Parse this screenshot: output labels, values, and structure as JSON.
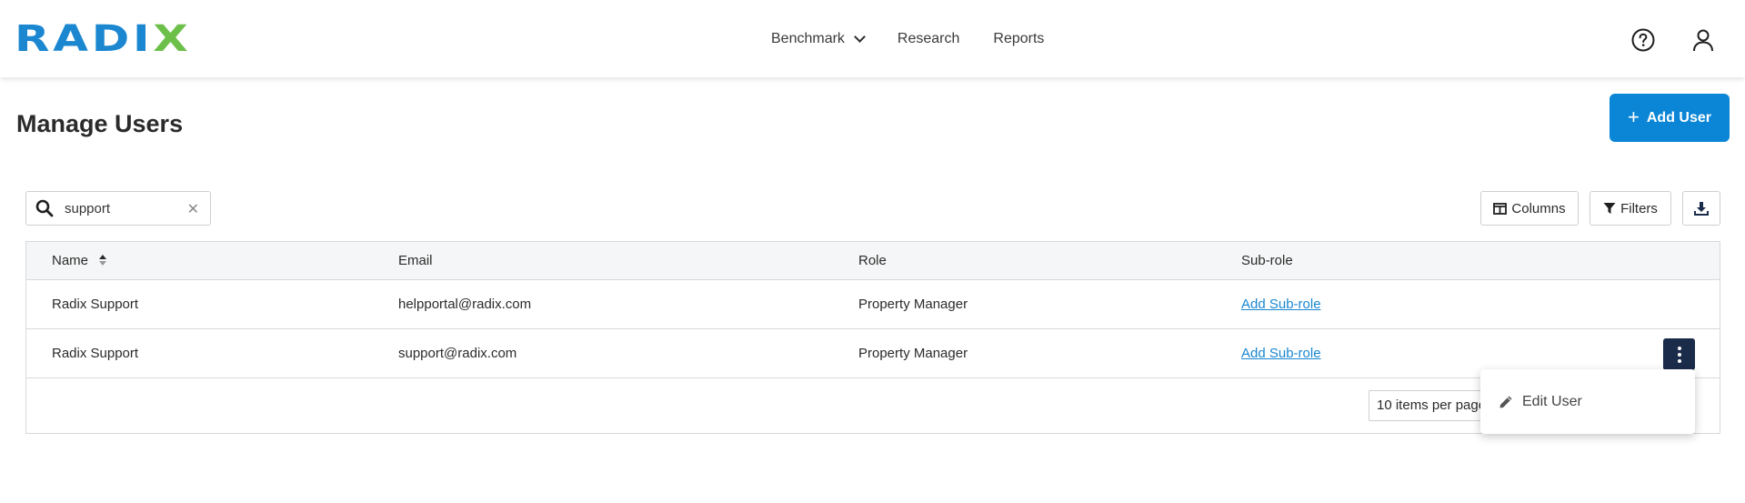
{
  "header": {
    "logo_main": "RADI",
    "logo_accent": "X",
    "nav": [
      {
        "label": "Benchmark",
        "has_dropdown": true
      },
      {
        "label": "Research"
      },
      {
        "label": "Reports"
      }
    ],
    "icons": {
      "help": "help-circle-icon",
      "user": "user-icon"
    }
  },
  "page": {
    "title": "Manage Users",
    "add_user_label": "Add User"
  },
  "toolbar": {
    "search_value": "support",
    "columns_label": "Columns",
    "filters_label": "Filters"
  },
  "table": {
    "headers": {
      "name": "Name",
      "email": "Email",
      "role": "Role",
      "subrole": "Sub-role"
    },
    "rows": [
      {
        "name": "Radix Support",
        "email": "helpportal@radix.com",
        "role": "Property Manager",
        "subrole_link": "Add Sub-role"
      },
      {
        "name": "Radix Support",
        "email": "support@radix.com",
        "role": "Property Manager",
        "subrole_link": "Add Sub-role"
      }
    ],
    "per_page_label": "10 items per page"
  },
  "row_menu": {
    "edit_label": "Edit User"
  },
  "colors": {
    "brand_blue": "#0b86d6",
    "brand_green": "#6cc04a",
    "kebab_bg": "#1b2b4a",
    "link": "#1a87d0"
  }
}
